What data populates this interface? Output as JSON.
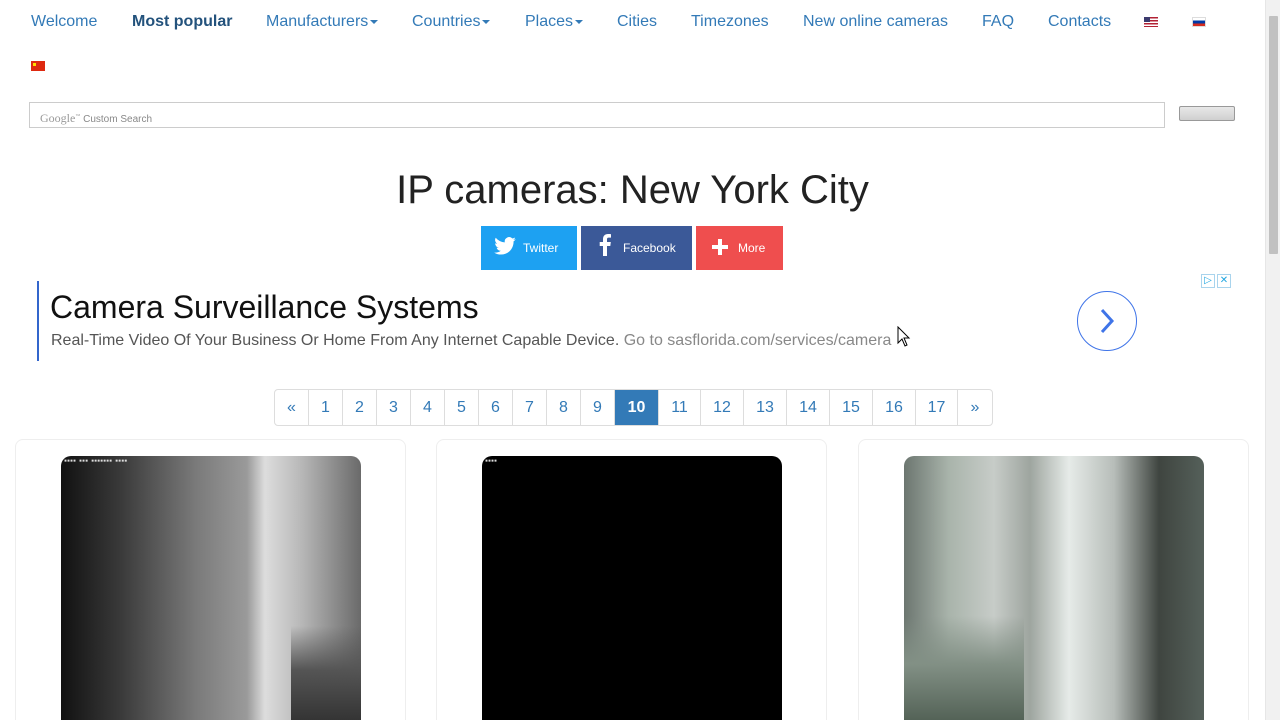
{
  "nav": {
    "items": [
      {
        "label": "Welcome",
        "dropdown": false,
        "active": false
      },
      {
        "label": "Most popular",
        "dropdown": false,
        "active": true
      },
      {
        "label": "Manufacturers",
        "dropdown": true,
        "active": false
      },
      {
        "label": "Countries",
        "dropdown": true,
        "active": false
      },
      {
        "label": "Places",
        "dropdown": true,
        "active": false
      },
      {
        "label": "Cities",
        "dropdown": false,
        "active": false
      },
      {
        "label": "Timezones",
        "dropdown": false,
        "active": false
      },
      {
        "label": "New online cameras",
        "dropdown": false,
        "active": false
      },
      {
        "label": "FAQ",
        "dropdown": false,
        "active": false
      },
      {
        "label": "Contacts",
        "dropdown": false,
        "active": false
      }
    ],
    "languages": [
      "us-flag-icon",
      "ru-flag-icon",
      "cn-flag-icon"
    ]
  },
  "search": {
    "placeholder_brand": "Google",
    "placeholder_text": "Custom Search"
  },
  "page": {
    "title": "IP cameras: New York City"
  },
  "share": {
    "twitter": "Twitter",
    "facebook": "Facebook",
    "more": "More"
  },
  "ad": {
    "headline": "Camera Surveillance Systems",
    "description": "Real-Time Video Of Your Business Or Home From Any Internet Capable Device.",
    "url_text": "Go to sasflorida.com/services/camera"
  },
  "pagination": {
    "prev": "«",
    "next": "»",
    "pages": [
      "1",
      "2",
      "3",
      "4",
      "5",
      "6",
      "7",
      "8",
      "9",
      "10",
      "11",
      "12",
      "13",
      "14",
      "15",
      "16",
      "17"
    ],
    "current": "10"
  },
  "colors": {
    "link": "#337ab7",
    "twitter": "#1da1f2",
    "facebook": "#3b5998",
    "more": "#ef4e4e"
  }
}
